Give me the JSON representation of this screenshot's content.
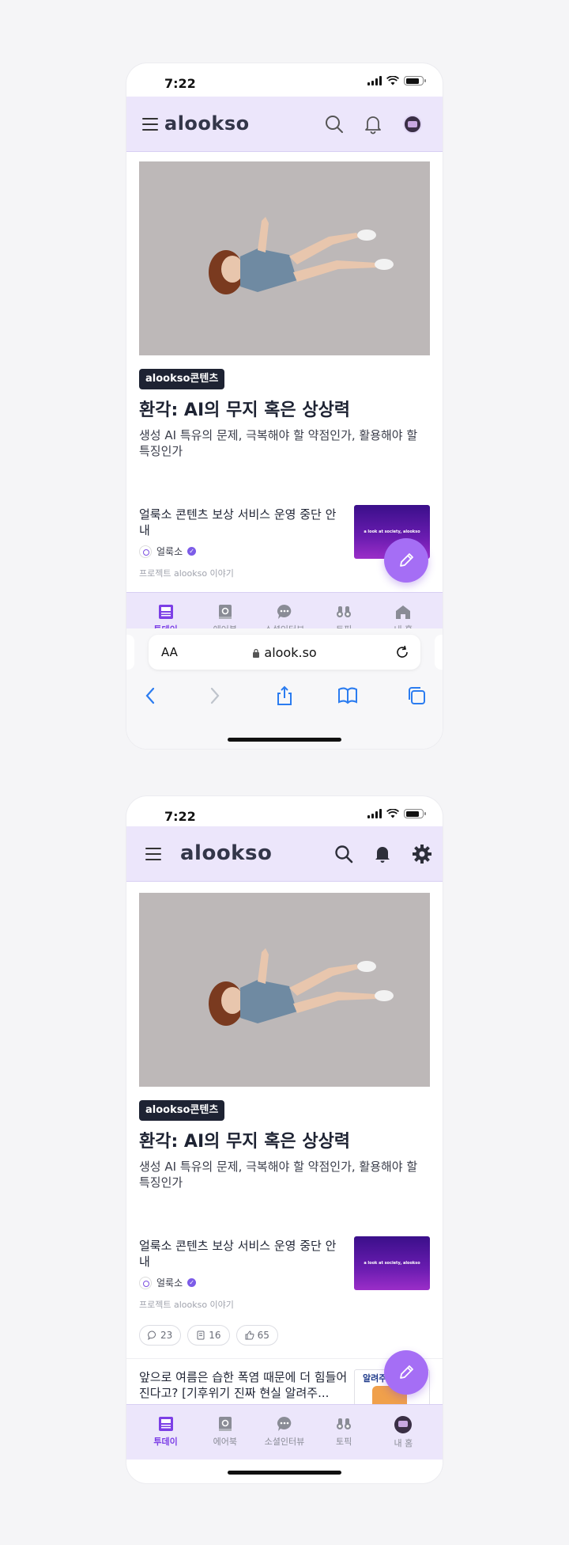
{
  "screen1": {
    "status": {
      "time": "7:22"
    },
    "header": {
      "logo": "alookso"
    },
    "article": {
      "badge": "alookso콘텐츠",
      "headline": "환각: AI의 무지 혹은 상상력",
      "subhead": "생성 AI 특유의 문제, 극복해야 할 약점인가, 활용해야 할 특징인가"
    },
    "news": {
      "title": "얼룩소 콘텐츠 보상 서비스 운영 중단 안내",
      "author": "얼룩소",
      "project": "프로젝트 alookso 이야기",
      "thumb_text": "a look at society, alookso"
    },
    "tabs": [
      {
        "label": "투데이",
        "icon": "newspaper-icon"
      },
      {
        "label": "에어북",
        "icon": "airbook-icon"
      },
      {
        "label": "소셜인터뷰",
        "icon": "chat-bubble-icon"
      },
      {
        "label": "토픽",
        "icon": "binoculars-icon"
      },
      {
        "label": "내 홈",
        "icon": "home-icon"
      }
    ],
    "safari": {
      "aa": "AA",
      "url": "alook.so"
    }
  },
  "screen2": {
    "status": {
      "time": "7:22"
    },
    "header": {
      "logo": "alookso"
    },
    "article": {
      "badge": "alookso콘텐츠",
      "headline": "환각: AI의 무지 혹은 상상력",
      "subhead": "생성 AI 특유의 문제, 극복해야 할 약점인가, 활용해야 할 특징인가"
    },
    "news": {
      "title": "얼룩소 콘텐츠 보상 서비스 운영 중단 안내",
      "author": "얼룩소",
      "project": "프로젝트 alookso 이야기",
      "thumb_text": "a look at society, alookso",
      "comments": "23",
      "bookmarks": "16",
      "likes": "65"
    },
    "news2": {
      "title": "앞으로 여름은 습한 폭염 때문에 더 힘들어진다고? [기후위기 진짜 현실 알려주...",
      "thumb_text": "알려주는 남"
    },
    "tabs": [
      {
        "label": "투데이",
        "icon": "newspaper-icon"
      },
      {
        "label": "에어북",
        "icon": "airbook-icon"
      },
      {
        "label": "소셜인터뷰",
        "icon": "chat-bubble-icon"
      },
      {
        "label": "토픽",
        "icon": "binoculars-icon"
      },
      {
        "label": "내 홈",
        "icon": "avatar-icon"
      }
    ]
  },
  "colors": {
    "accent": "#7c3fe6",
    "header_bg": "#ece6fb",
    "fab": "#a56ef5",
    "badge_bg": "#1e2333"
  }
}
